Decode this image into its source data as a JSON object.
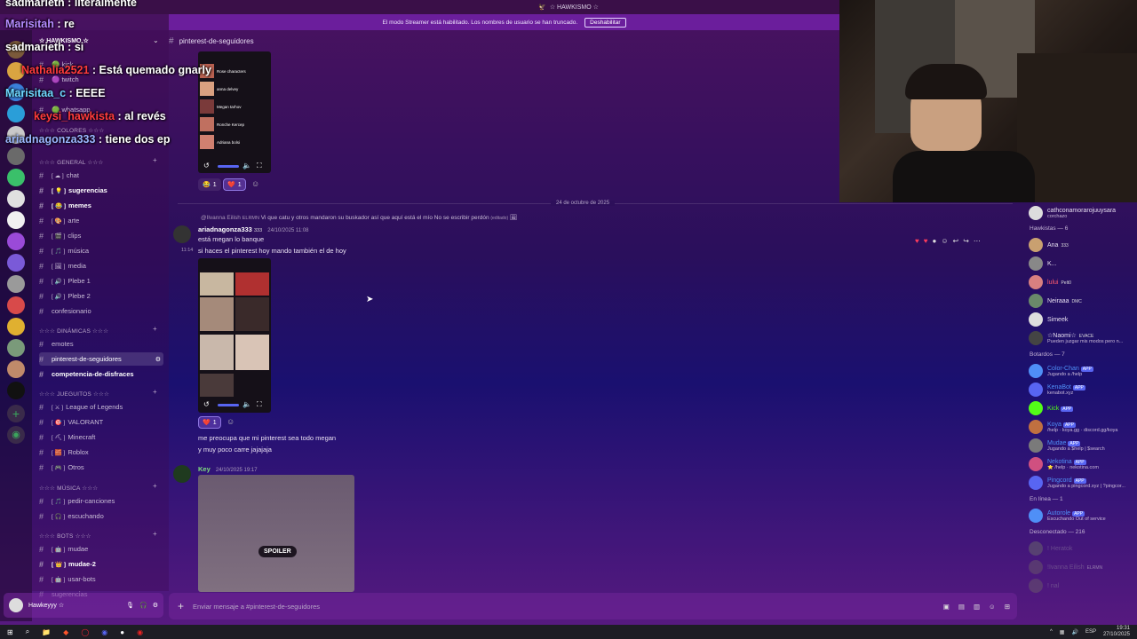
{
  "window": {
    "title": "☆ HAWKISMO ☆"
  },
  "streamer_bar": {
    "message": "El modo Streamer está habilitado. Los nombres de usuario se han truncado.",
    "button": "Deshabilitar"
  },
  "server": {
    "name": "☆ HAWKISMO ☆"
  },
  "sidebar": {
    "top_channels": [
      {
        "icon": "🟢",
        "label": "kick"
      },
      {
        "icon": "🟣",
        "label": "twitch"
      },
      {
        "icon": "🟢",
        "label": "whatsapp"
      }
    ],
    "categories": [
      {
        "label": "☆☆☆ COLORES ☆☆☆",
        "collapsed": true
      },
      {
        "label": "☆☆☆ GENERAL ☆☆☆"
      },
      {
        "label": "☆☆☆ DINÁMICAS ☆☆☆"
      },
      {
        "label": "☆☆☆ JUEGUITOS ☆☆☆"
      },
      {
        "label": "☆☆☆ MÚSICA ☆☆☆"
      },
      {
        "label": "☆☆☆ BOTS ☆☆☆"
      }
    ],
    "general": [
      {
        "label": "chat",
        "deco": "[ ☁ ]"
      },
      {
        "label": "sugerencias",
        "deco": "[ 💡 ]",
        "bold": true
      },
      {
        "label": "memes",
        "deco": "[ 😂 ]",
        "bold": true
      },
      {
        "label": "arte",
        "deco": "[ 🎨 ]"
      },
      {
        "label": "clips",
        "deco": "[ 🎬 ]"
      },
      {
        "label": "música",
        "deco": "[ 🎵 ]"
      },
      {
        "label": "media",
        "deco": "[ 🖼 ]"
      },
      {
        "label": "Plebe 1",
        "deco": "[ 🔊 ]"
      },
      {
        "label": "Plebe 2",
        "deco": "[ 🔊 ]"
      },
      {
        "label": "confesionario",
        "deco": ""
      }
    ],
    "dinamicas": [
      {
        "label": "emotes"
      },
      {
        "label": "pinterest-de-seguidores",
        "active": true
      },
      {
        "label": "competencia-de-disfraces",
        "bold": true
      }
    ],
    "jueguitos": [
      {
        "label": "League of Legends",
        "deco": "[ ⚔ ]"
      },
      {
        "label": "VALORANT",
        "deco": "[ 🎯 ]"
      },
      {
        "label": "Minecraft",
        "deco": "[ ⛏ ]"
      },
      {
        "label": "Roblox",
        "deco": "[ 🧱 ]"
      },
      {
        "label": "Otros",
        "deco": "[ 🎮 ]"
      }
    ],
    "musica": [
      {
        "label": "pedir-canciones",
        "deco": "[ 🎵 ]"
      },
      {
        "label": "escuchando",
        "deco": "[ 🎧 ]"
      }
    ],
    "bots": [
      {
        "label": "mudae",
        "deco": "[ 🤖 ]"
      },
      {
        "label": "mudae-2",
        "deco": "[ 👑 ]",
        "bold": true
      },
      {
        "label": "usar-bots",
        "deco": "[ 🤖 ]"
      },
      {
        "label": "sugerencias",
        "deco": ""
      }
    ]
  },
  "user_panel": {
    "name": "Hawkeyyy ☆"
  },
  "channel": {
    "name": "pinterest-de-seguidores"
  },
  "messages": {
    "first_media_labels": [
      "Rose characters",
      "anna delvey",
      "Megan tarhov",
      "Ronche Kercep",
      "Adriana bolsi"
    ],
    "first_reactions": [
      {
        "emoji": "😂",
        "count": "1"
      },
      {
        "emoji": "❤️",
        "count": "1"
      }
    ],
    "date_divider": "24 de octubre de 2025",
    "reply_to": "@Ilvanna Eilish",
    "reply_tag": "ELRMN",
    "reply_text": "Vi que catu y otros mandaron su buskador así que aquí está el mío  No se escribir perdón",
    "reply_edited": "(editado)",
    "author": "ariadnagonza333",
    "author_tag": "333",
    "author_ts": "24/10/2025 11:08",
    "line1": "está megan lo banque",
    "hover_time": "11:14",
    "line2": "si haces el pinterest hoy mando también el de hoy",
    "second_reactions": [
      {
        "emoji": "❤️",
        "count": "1"
      }
    ],
    "line3": "me preocupa que mi pinterest sea todo megan",
    "line4": "y muy poco carre jajajaja",
    "author2": "Key",
    "author2_ts": "24/10/2025 19:17",
    "spoiler_label": "SPOILER"
  },
  "composer": {
    "placeholder": "Enviar mensaje a #pinterest-de-seguidores"
  },
  "members": {
    "top_user": {
      "name": "cathconamorarojuuysara",
      "sub": "corchazo"
    },
    "groups": [
      {
        "label": "Hawkistas — 6",
        "items": [
          {
            "name": "Ana",
            "tag": "333",
            "color": "#e6def0",
            "sub": ""
          },
          {
            "name": "K...",
            "tag": "",
            "color": "#e6def0",
            "sub": ""
          },
          {
            "name": "lului",
            "tag": "Pelt0",
            "color": "#ff5a6e",
            "sub": ""
          },
          {
            "name": "Neiraaa",
            "tag": "DMC",
            "color": "#e6def0",
            "sub": ""
          },
          {
            "name": "Simeek",
            "tag": "",
            "color": "#e6def0",
            "sub": ""
          },
          {
            "name": "☆Naomi☆",
            "tag": "EVACE",
            "color": "#e6def0",
            "sub": "Pueden juzgar mis modos pero n..."
          }
        ]
      },
      {
        "label": "Botardos — 7",
        "items": [
          {
            "name": "Color-Chan",
            "app": "APP",
            "color": "#4f8ff7",
            "sub": "Jugando a /help"
          },
          {
            "name": "KenaBot",
            "app": "APP",
            "color": "#4f8ff7",
            "sub": "kenabot.xyz"
          },
          {
            "name": "Kick",
            "app": "APP",
            "color": "#53fc18",
            "sub": ""
          },
          {
            "name": "Koya",
            "app": "APP",
            "color": "#4f8ff7",
            "sub": "/help · koya.gg · discord.gg/koya"
          },
          {
            "name": "Mudae",
            "app": "APP",
            "color": "#4f8ff7",
            "sub": "Jugando a $help | $search"
          },
          {
            "name": "Nekotina",
            "app": "APP",
            "color": "#4f8ff7",
            "sub": "⭐ /help · nekotina.com"
          },
          {
            "name": "Pingcord",
            "app": "APP",
            "color": "#4f8ff7",
            "sub": "Jugando a pingcord.xyz | ?pingcor..."
          }
        ]
      },
      {
        "label": "En línea — 1",
        "items": [
          {
            "name": "Autorole",
            "app": "APP",
            "color": "#4f8ff7",
            "sub": "Escuchando Out of service"
          }
        ]
      },
      {
        "label": "Desconectado — 216",
        "items": [
          {
            "name": "! Heratok",
            "tag": "",
            "color": "#8f7fa0",
            "sub": ""
          },
          {
            "name": "!Ivanna Eilish",
            "tag": "ELRMN",
            "color": "#8f7fa0",
            "sub": ""
          },
          {
            "name": "! nal",
            "tag": "",
            "color": "#8f7fa0",
            "sub": ""
          }
        ]
      }
    ]
  },
  "chat_overlay": [
    {
      "user": "sadmarieth",
      "color": "#ffffff",
      "text": "literalmente"
    },
    {
      "user": "Marisitah",
      "color": "#b48cff",
      "text": "re"
    },
    {
      "user": "sadmarieth",
      "color": "#ffffff",
      "text": "si"
    },
    {
      "user": "Nathalia2521",
      "color": "#ff3b3b",
      "text": "Está quemado gnarly"
    },
    {
      "user": "Marisitaa_c",
      "color": "#6fd9ff",
      "text": "EEEE"
    },
    {
      "user": "keysi_hawkista",
      "color": "#ff3b3b",
      "text": "al revés"
    },
    {
      "user": "ariadnagonza333",
      "color": "#9bb6ff",
      "text": "tiene dos ep"
    }
  ],
  "taskbar": {
    "lang": "ESP",
    "time": "19:31",
    "date": "27/10/2025"
  },
  "colors": {
    "accent": "#5865f2",
    "streamer_bar": "#6b1e9c",
    "heart": "#ff3b5c"
  }
}
